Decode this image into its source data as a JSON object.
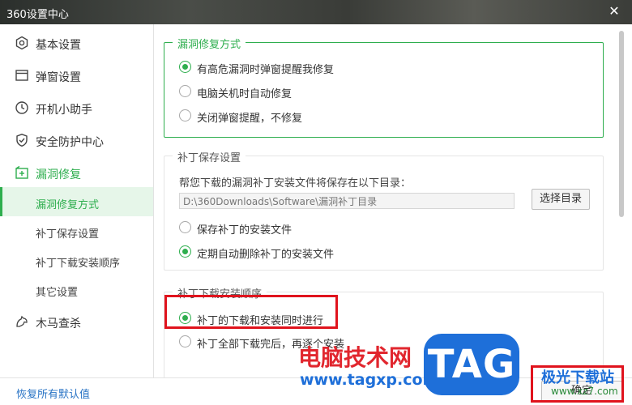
{
  "window": {
    "title": "360设置中心",
    "close_glyph": "✕"
  },
  "sidebar": {
    "items": [
      {
        "label": "基本设置",
        "icon": "hexagon-gear-icon"
      },
      {
        "label": "弹窗设置",
        "icon": "window-icon"
      },
      {
        "label": "开机小助手",
        "icon": "clock-icon"
      },
      {
        "label": "安全防护中心",
        "icon": "shield-icon"
      },
      {
        "label": "漏洞修复",
        "icon": "plus-box-icon"
      },
      {
        "label": "木马查杀",
        "icon": "horse-icon"
      }
    ],
    "subitems": [
      {
        "label": "漏洞修复方式",
        "active": true
      },
      {
        "label": "补丁保存设置",
        "active": false
      },
      {
        "label": "补丁下载安装顺序",
        "active": false
      },
      {
        "label": "其它设置",
        "active": false
      }
    ]
  },
  "repair_mode": {
    "legend": "漏洞修复方式",
    "options": [
      {
        "label": "有高危漏洞时弹窗提醒我修复",
        "checked": true
      },
      {
        "label": "电脑关机时自动修复",
        "checked": false
      },
      {
        "label": "关闭弹窗提醒，不修复",
        "checked": false
      }
    ]
  },
  "patch_save": {
    "legend": "补丁保存设置",
    "description": "帮您下载的漏洞补丁安装文件将保存在以下目录：",
    "path": "D:\\360Downloads\\Software\\漏洞补丁目录",
    "choose_button": "选择目录",
    "options": [
      {
        "label": "保存补丁的安装文件",
        "checked": false
      },
      {
        "label": "定期自动删除补丁的安装文件",
        "checked": true
      }
    ]
  },
  "download_order": {
    "legend": "补丁下载安装顺序",
    "options": [
      {
        "label": "补丁的下载和安装同时进行",
        "checked": true
      },
      {
        "label": "补丁全部下载完后，再逐个安装",
        "checked": false
      }
    ]
  },
  "footer": {
    "restore_label": "恢复所有默认值",
    "ok_label": "确定"
  },
  "watermarks": {
    "site_cn": "电脑技术网",
    "site_url": "www.tagxp.com",
    "logo": "TAG",
    "corner_cn": "极光下载站",
    "corner_url": "www.xz7.com"
  },
  "colors": {
    "accent": "#2eae4e",
    "link": "#2a74c5",
    "highlight": "#e0131d",
    "watermark_red": "#e1262e",
    "watermark_blue": "#1e6fd9"
  }
}
